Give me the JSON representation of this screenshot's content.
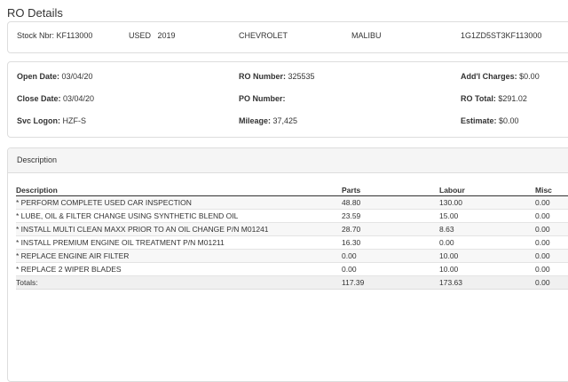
{
  "page_title": "RO Details",
  "vehicle": {
    "stock": "Stock Nbr: KF113000",
    "condition_year": "USED   2019",
    "make": "CHEVROLET",
    "model": "MALIBU",
    "vin": "1G1ZD5ST3KF113000"
  },
  "ro": {
    "open_date_label": "Open Date:",
    "open_date": "03/04/20",
    "close_date_label": "Close Date:",
    "close_date": "03/04/20",
    "svc_logon_label": "Svc Logon:",
    "svc_logon": "HZF-S",
    "ro_number_label": "RO Number:",
    "ro_number": "325535",
    "po_number_label": "PO Number:",
    "po_number": "",
    "mileage_label": "Mileage:",
    "mileage": "37,425",
    "addl_charges_label": "Add'l Charges:",
    "addl_charges": "$0.00",
    "ro_total_label": "RO Total:",
    "ro_total": "$291.02",
    "estimate_label": "Estimate:",
    "estimate": "$0.00"
  },
  "description_panel": {
    "title": "Description",
    "columns": [
      "Description",
      "Parts",
      "Labour",
      "Misc"
    ],
    "rows": [
      [
        "* PERFORM COMPLETE USED CAR INSPECTION",
        "48.80",
        "130.00",
        "0.00"
      ],
      [
        "* LUBE, OIL & FILTER CHANGE USING SYNTHETIC BLEND OIL",
        "23.59",
        "15.00",
        "0.00"
      ],
      [
        "* INSTALL MULTI CLEAN MAXX PRIOR TO AN OIL CHANGE P/N M01241",
        "28.70",
        "8.63",
        "0.00"
      ],
      [
        "* INSTALL PREMIUM ENGINE OIL TREATMENT P/N M01211",
        "16.30",
        "0.00",
        "0.00"
      ],
      [
        "* REPLACE ENGINE AIR FILTER",
        "0.00",
        "10.00",
        "0.00"
      ],
      [
        "* REPLACE 2 WIPER BLADES",
        "0.00",
        "10.00",
        "0.00"
      ]
    ],
    "totals": [
      "Totals:",
      "117.39",
      "173.63",
      "0.00"
    ]
  }
}
